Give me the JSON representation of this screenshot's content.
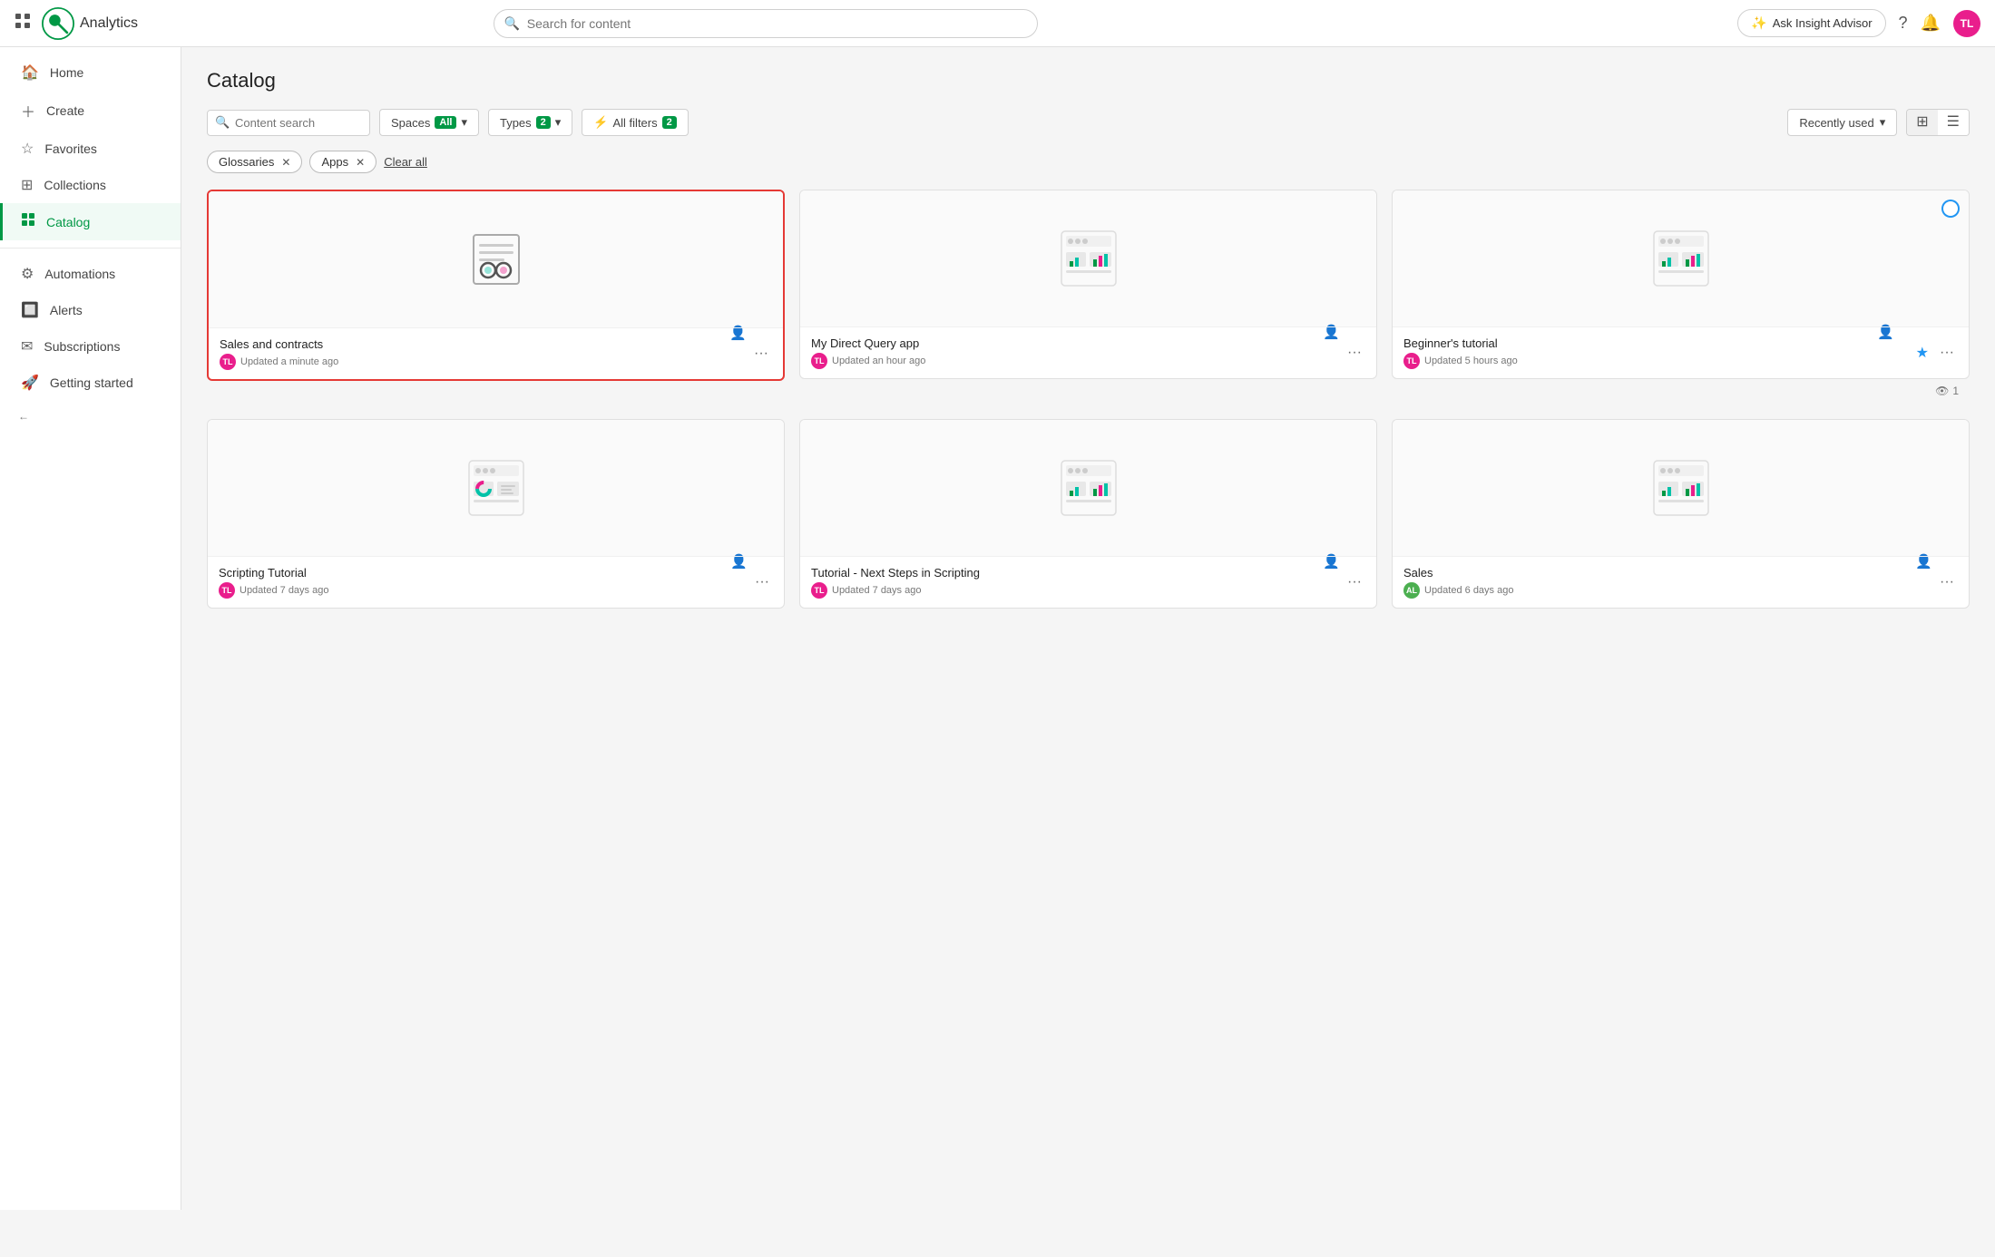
{
  "topNav": {
    "logoAlt": "Qlik",
    "appName": "Analytics",
    "searchPlaceholder": "Search for content",
    "insightAdvisorLabel": "Ask Insight Advisor",
    "userInitials": "TL"
  },
  "sidebar": {
    "items": [
      {
        "id": "home",
        "label": "Home",
        "icon": "home"
      },
      {
        "id": "create",
        "label": "Create",
        "icon": "plus"
      },
      {
        "id": "favorites",
        "label": "Favorites",
        "icon": "star"
      },
      {
        "id": "collections",
        "label": "Collections",
        "icon": "collections"
      },
      {
        "id": "catalog",
        "label": "Catalog",
        "icon": "catalog",
        "active": true
      },
      {
        "id": "automations",
        "label": "Automations",
        "icon": "automations"
      },
      {
        "id": "alerts",
        "label": "Alerts",
        "icon": "alerts"
      },
      {
        "id": "subscriptions",
        "label": "Subscriptions",
        "icon": "subscriptions"
      },
      {
        "id": "getting-started",
        "label": "Getting started",
        "icon": "rocket"
      }
    ],
    "collapseLabel": "←"
  },
  "main": {
    "pageTitle": "Catalog",
    "filters": {
      "searchPlaceholder": "Content search",
      "spacesLabel": "Spaces",
      "spacesBadge": "All",
      "typesLabel": "Types",
      "typesBadge": "2",
      "allFiltersLabel": "All filters",
      "allFiltersBadge": "2",
      "sortLabel": "Recently used",
      "gridViewTitle": "Grid view",
      "listViewTitle": "List view"
    },
    "activeTags": [
      {
        "label": "Glossaries"
      },
      {
        "label": "Apps"
      }
    ],
    "clearAllLabel": "Clear all",
    "cards": [
      {
        "id": "sales-contracts",
        "title": "Sales and contracts",
        "meta": "Updated a minute ago",
        "userInitials": "TL",
        "userColor": "#e91e8c",
        "iconType": "glossary",
        "highlighted": true,
        "hasStar": false,
        "hasBlueBadge": false,
        "views": null
      },
      {
        "id": "my-direct-query",
        "title": "My Direct Query app",
        "meta": "Updated an hour ago",
        "userInitials": "TL",
        "userColor": "#e91e8c",
        "iconType": "chart",
        "highlighted": false,
        "hasStar": false,
        "hasBlueBadge": false,
        "views": null
      },
      {
        "id": "beginners-tutorial",
        "title": "Beginner's tutorial",
        "meta": "Updated 5 hours ago",
        "userInitials": "TL",
        "userColor": "#e91e8c",
        "iconType": "chart",
        "highlighted": false,
        "hasStar": true,
        "hasBlueBadge": true,
        "views": "1"
      },
      {
        "id": "scripting-tutorial",
        "title": "Scripting Tutorial",
        "meta": "Updated 7 days ago",
        "userInitials": "TL",
        "userColor": "#e91e8c",
        "iconType": "chart2",
        "highlighted": false,
        "hasStar": false,
        "hasBlueBadge": false,
        "views": null
      },
      {
        "id": "tutorial-next-steps",
        "title": "Tutorial - Next Steps in Scripting",
        "meta": "Updated 7 days ago",
        "userInitials": "TL",
        "userColor": "#e91e8c",
        "iconType": "chart",
        "highlighted": false,
        "hasStar": false,
        "hasBlueBadge": false,
        "views": null
      },
      {
        "id": "sales",
        "title": "Sales",
        "meta": "Updated 6 days ago",
        "userInitials": "AL",
        "userColor": "#4caf50",
        "iconType": "chart",
        "highlighted": false,
        "hasStar": false,
        "hasBlueBadge": false,
        "views": null
      }
    ]
  }
}
